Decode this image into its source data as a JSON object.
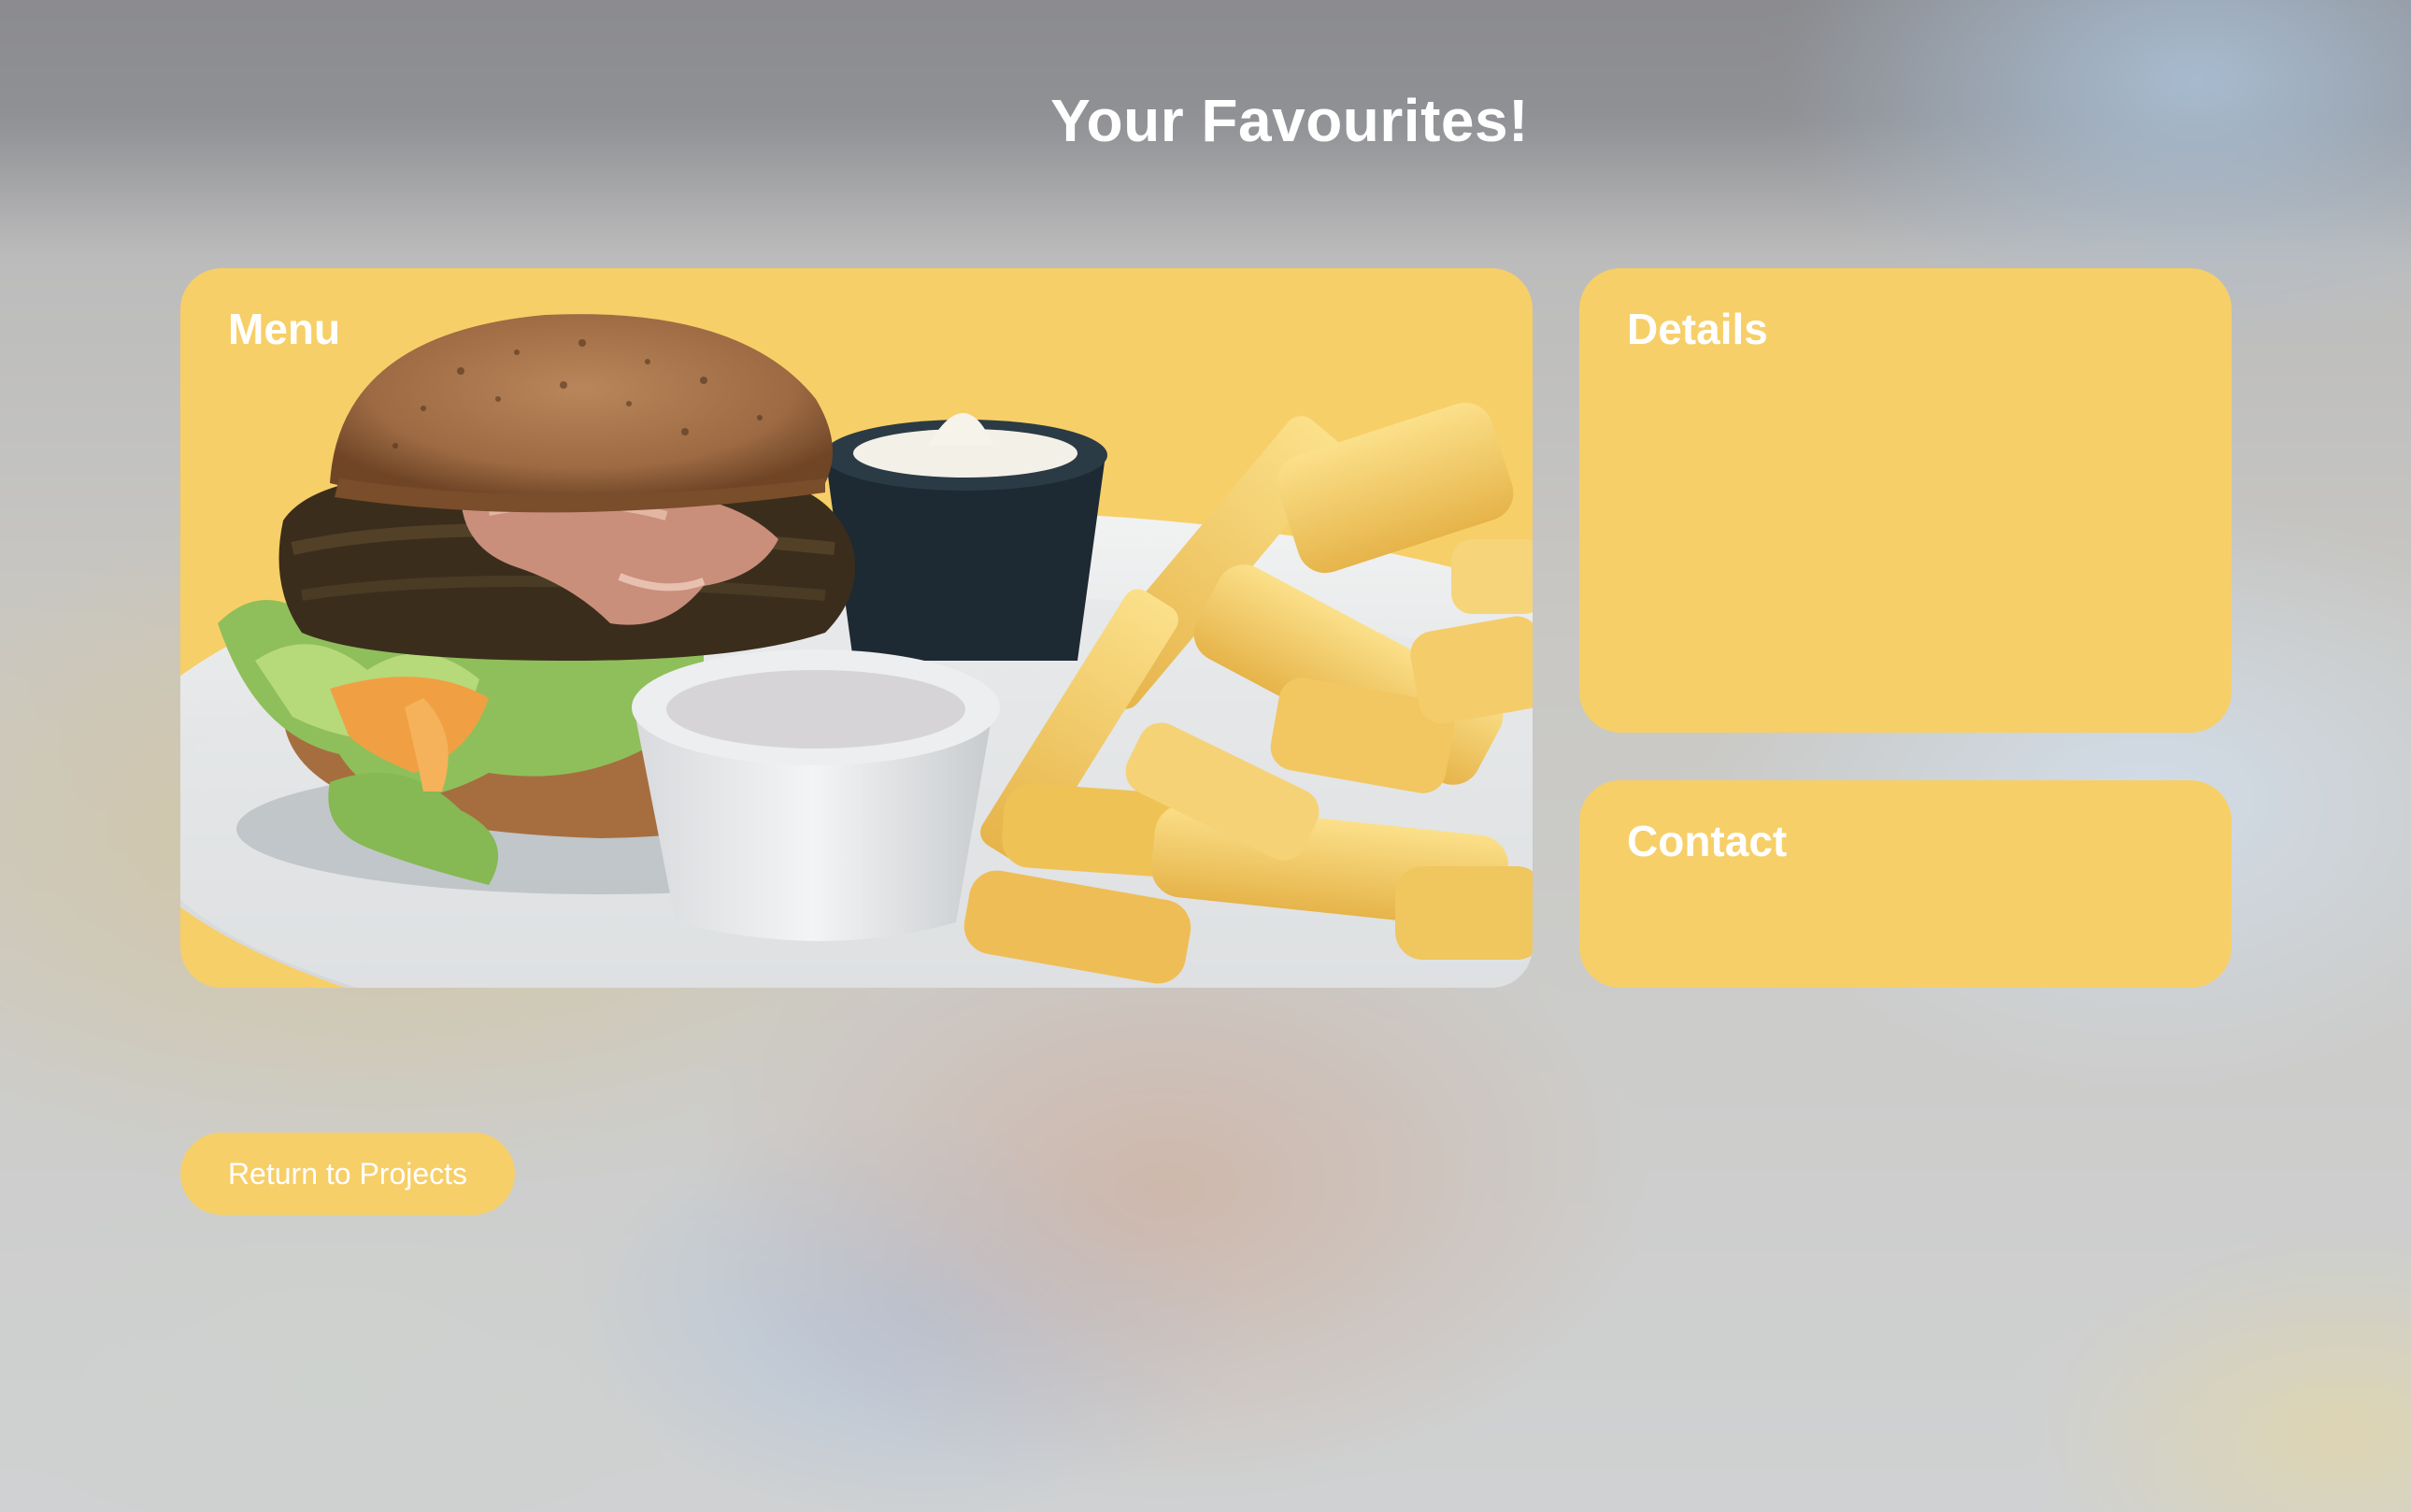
{
  "page": {
    "title": "Your Favourites!"
  },
  "cards": {
    "menu": {
      "label": "Menu",
      "image": "burger-and-fries-photo"
    },
    "details": {
      "label": "Details"
    },
    "contact": {
      "label": "Contact"
    }
  },
  "actions": {
    "return_label": "Return to Projects"
  },
  "colors": {
    "card_yellow": "#f7cf68",
    "text_white": "#ffffff"
  }
}
